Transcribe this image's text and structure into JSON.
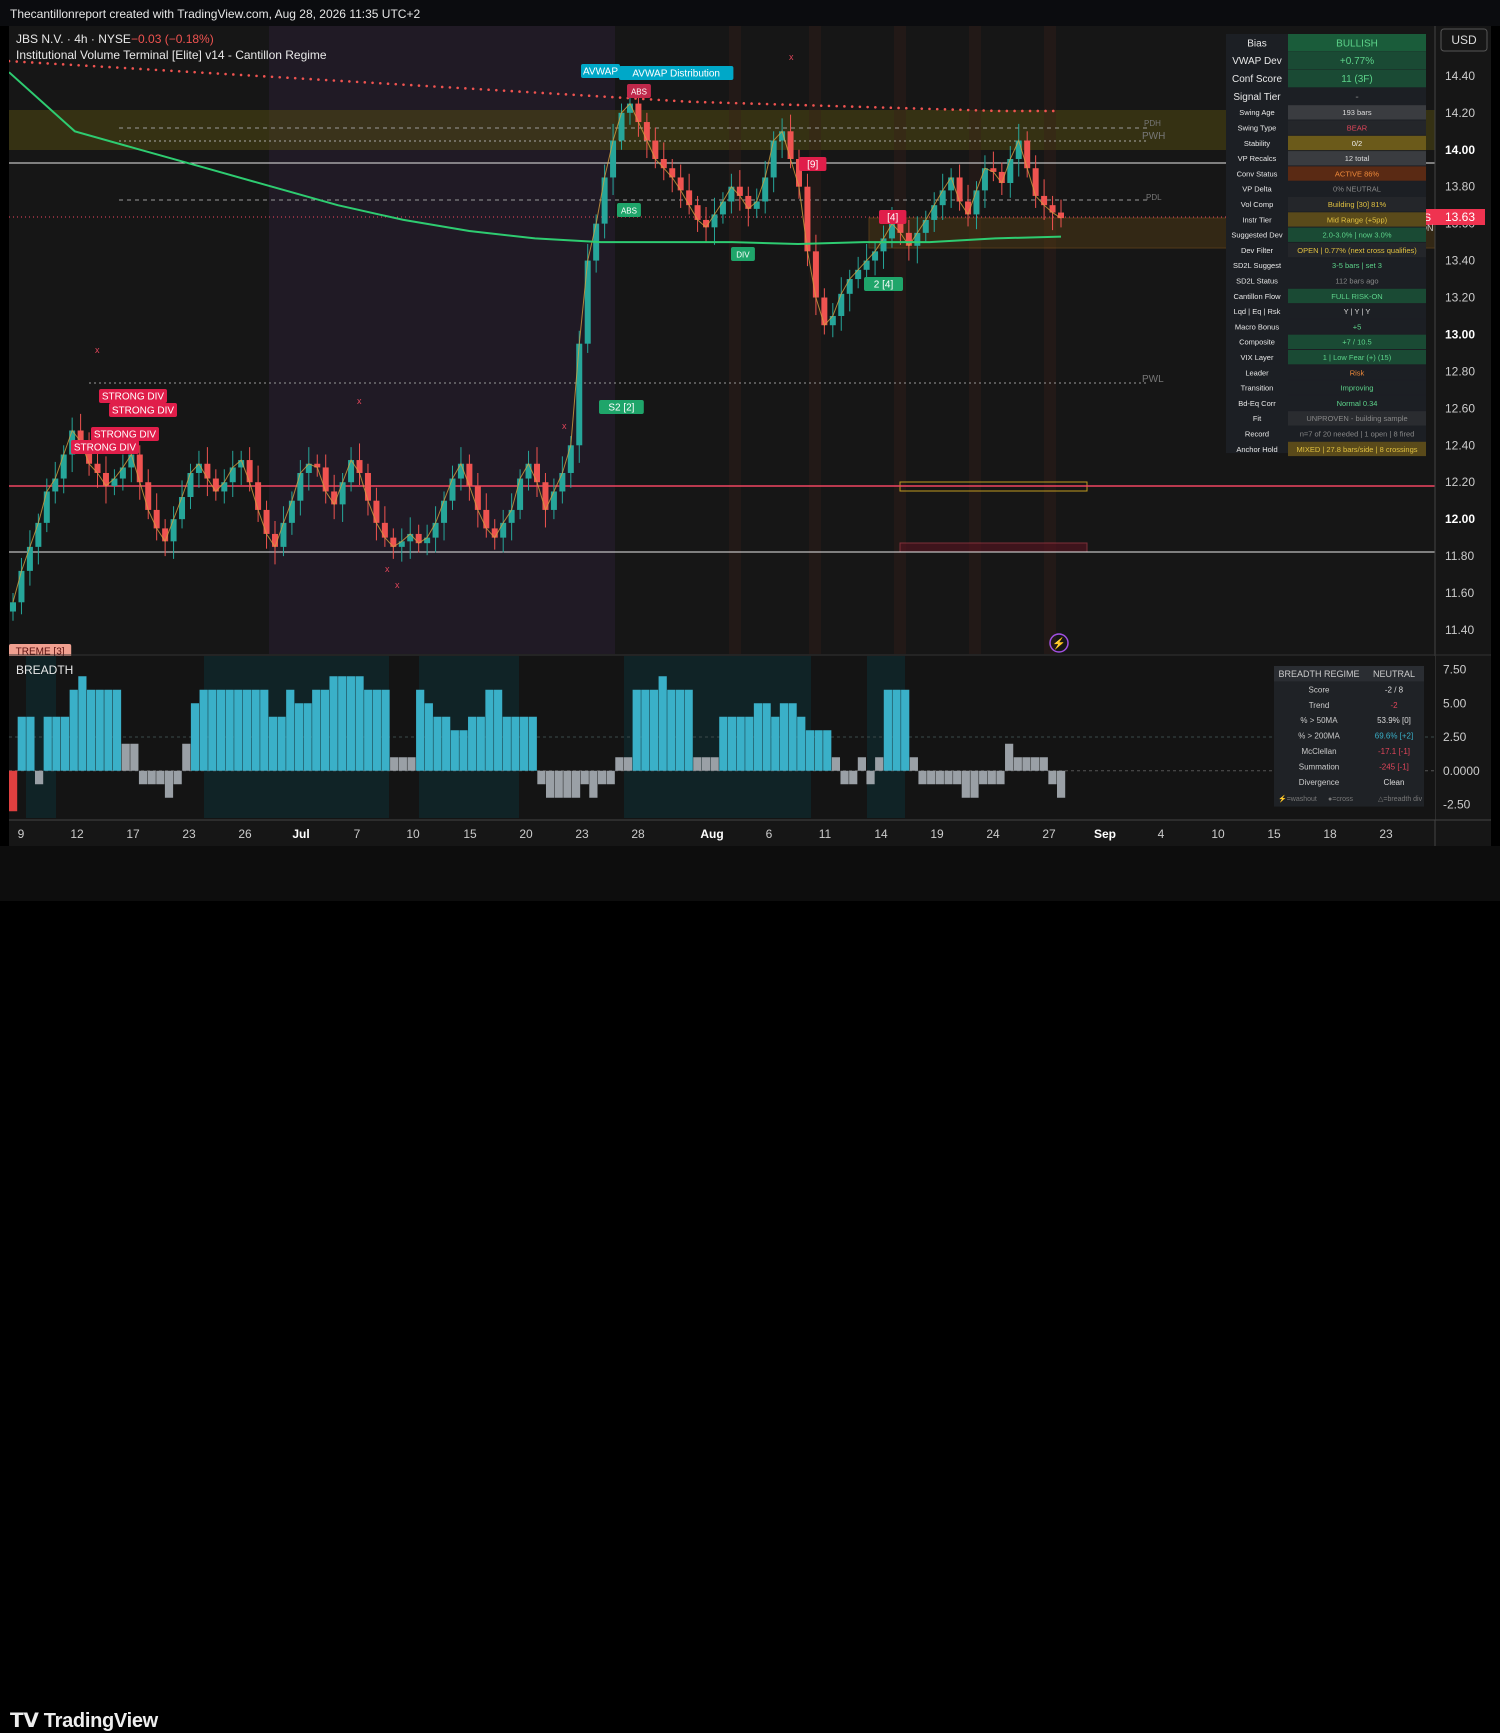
{
  "header": {
    "caption": "Thecantillonreport created with TradingView.com, Aug 28, 2026 11:35 UTC+2"
  },
  "symbol": {
    "line1_name": "JBS N.V. · 4h · NYSE",
    "line1_change": "−0.03 (−0.18%)",
    "indicator_title": "Institutional Volume Terminal [Elite] v14 - Cantillon Regime"
  },
  "currency_button": "USD",
  "price_tag": {
    "ticker": "JBS",
    "price": "13.63"
  },
  "footer": {
    "logo": "TradingView"
  },
  "colors": {
    "up": "#26a69a",
    "down": "#ef5350",
    "bg": "#161616",
    "breadth_up": "#3ab0c8",
    "breadth_neutral": "#9aa0a6"
  },
  "chart_data": [
    {
      "type": "candlestick",
      "title": "JBS N.V. · 4h · NYSE",
      "y_ticks": [
        "14.40",
        "14.20",
        "14.00",
        "13.80",
        "13.60",
        "13.40",
        "13.20",
        "13.00",
        "12.80",
        "12.60",
        "12.40",
        "12.20",
        "12.00",
        "11.80",
        "11.60",
        "11.40"
      ],
      "ylim": [
        11.27,
        14.67
      ],
      "last_price": 13.63,
      "x_ticks": [
        "9",
        "12",
        "17",
        "23",
        "26",
        "Jul",
        "7",
        "10",
        "15",
        "20",
        "23",
        "28",
        "Aug",
        "6",
        "11",
        "14",
        "19",
        "24",
        "27",
        "Sep",
        "4",
        "10",
        "15",
        "18",
        "23"
      ],
      "closes": [
        11.55,
        11.72,
        11.85,
        11.98,
        12.15,
        12.22,
        12.35,
        12.48,
        12.42,
        12.3,
        12.25,
        12.18,
        12.22,
        12.28,
        12.35,
        12.2,
        12.05,
        11.95,
        11.88,
        12.0,
        12.12,
        12.25,
        12.3,
        12.22,
        12.15,
        12.2,
        12.28,
        12.32,
        12.2,
        12.05,
        11.92,
        11.85,
        11.98,
        12.1,
        12.25,
        12.3,
        12.28,
        12.15,
        12.08,
        12.2,
        12.32,
        12.25,
        12.1,
        11.98,
        11.9,
        11.85,
        11.88,
        11.92,
        11.87,
        11.9,
        11.98,
        12.1,
        12.22,
        12.3,
        12.18,
        12.05,
        11.95,
        11.9,
        11.98,
        12.05,
        12.22,
        12.3,
        12.2,
        12.05,
        12.15,
        12.25,
        12.4,
        12.95,
        13.4,
        13.6,
        13.85,
        14.05,
        14.2,
        14.25,
        14.15,
        14.05,
        13.95,
        13.9,
        13.85,
        13.78,
        13.7,
        13.62,
        13.58,
        13.65,
        13.72,
        13.8,
        13.75,
        13.68,
        13.72,
        13.85,
        14.05,
        14.1,
        13.95,
        13.8,
        13.45,
        13.2,
        13.05,
        13.1,
        13.22,
        13.3,
        13.35,
        13.4,
        13.45,
        13.52,
        13.6,
        13.55,
        13.48,
        13.55,
        13.62,
        13.7,
        13.78,
        13.85,
        13.72,
        13.65,
        13.78,
        13.9,
        13.88,
        13.82,
        13.95,
        14.05,
        13.9,
        13.75,
        13.7,
        13.66,
        13.63
      ],
      "annotations": [
        "STRONG DIV",
        "STRONG DIV",
        "STRONG DIV",
        "STRONG DIV",
        "S2 [2]",
        "ABS",
        "ABS",
        "DIV",
        "[9]",
        "[4]",
        "2 [4]",
        "AVWAP",
        "AVWAP Distribution",
        "PDH",
        "PWH",
        "PDL",
        "PWL",
        "INSTITUTION",
        "TREME [3]"
      ],
      "series": [
        {
          "name": "AVWAP",
          "values": [
            14.48,
            14.46,
            14.44,
            14.42,
            14.4,
            14.38,
            14.36,
            14.34,
            14.32,
            14.3,
            14.28,
            14.26,
            14.25,
            14.24,
            14.23,
            14.22,
            14.21,
            14.21
          ]
        },
        {
          "name": "Long MA",
          "values": [
            14.42,
            14.1,
            14.0,
            13.9,
            13.8,
            13.7,
            13.62,
            13.56,
            13.52,
            13.5,
            13.5,
            13.5,
            13.49,
            13.5,
            13.5,
            13.52,
            13.53
          ]
        }
      ]
    },
    {
      "type": "bar",
      "title": "BREADTH",
      "y_ticks": [
        "7.50",
        "5.00",
        "2.50",
        "0.0000",
        "-2.50"
      ],
      "ylim": [
        -3.5,
        8.5
      ],
      "values": [
        -3,
        4,
        4,
        -1,
        4,
        4,
        4,
        6,
        7,
        6,
        6,
        6,
        6,
        2,
        2,
        -1,
        -1,
        -1,
        -2,
        -1,
        2,
        5,
        6,
        6,
        6,
        6,
        6,
        6,
        6,
        6,
        4,
        4,
        6,
        5,
        5,
        6,
        6,
        7,
        7,
        7,
        7,
        6,
        6,
        6,
        1,
        1,
        1,
        6,
        5,
        4,
        4,
        3,
        3,
        4,
        4,
        6,
        6,
        4,
        4,
        4,
        4,
        -1,
        -2,
        -2,
        -2,
        -2,
        -1,
        -2,
        -1,
        -1,
        1,
        1,
        6,
        6,
        6,
        7,
        6,
        6,
        6,
        1,
        1,
        1,
        4,
        4,
        4,
        4,
        5,
        5,
        4,
        5,
        5,
        4,
        3,
        3,
        3,
        1,
        -1,
        -1,
        1,
        -1,
        1,
        6,
        6,
        6,
        1,
        -1,
        -1,
        -1,
        -1,
        -1,
        -2,
        -2,
        -1,
        -1,
        -1,
        2,
        1,
        1,
        1,
        1,
        -1,
        -2
      ]
    }
  ],
  "regime_table": [
    {
      "k": "Bias",
      "v": "BULLISH",
      "bg": "#1a5c3a",
      "fg": "#5cd38a"
    },
    {
      "k": "VWAP Dev",
      "v": "+0.77%",
      "bg": "#1a4a34",
      "fg": "#5cd38a"
    },
    {
      "k": "Conf Score",
      "v": "11 (3F)",
      "bg": "#1a4a34",
      "fg": "#5cd38a"
    },
    {
      "k": "Signal Tier",
      "v": "-",
      "bg": "#1c1f24",
      "fg": "#888"
    },
    {
      "k": "Swing Age",
      "v": "193 bars",
      "bg": "#3a3c40",
      "fg": "#ddd"
    },
    {
      "k": "Swing Type",
      "v": "BEAR",
      "bg": "#24262a",
      "fg": "#e0455a"
    },
    {
      "k": "Stability",
      "v": "0/2",
      "bg": "#6b5a1a",
      "fg": "#eee"
    },
    {
      "k": "VP Recalcs",
      "v": "12 total",
      "bg": "#3a3c40",
      "fg": "#ddd"
    },
    {
      "k": "Conv Status",
      "v": "ACTIVE 86%",
      "bg": "#5a2a14",
      "fg": "#f08a3a"
    },
    {
      "k": "VP Delta",
      "v": "0% NEUTRAL",
      "bg": "#1c1f24",
      "fg": "#888"
    },
    {
      "k": "Vol Comp",
      "v": "Building [30] 81%",
      "bg": "#24262a",
      "fg": "#e0c040"
    },
    {
      "k": "Instr Tier",
      "v": "Mid Range (+5pp)",
      "bg": "#5a4a1a",
      "fg": "#e0c040"
    },
    {
      "k": "Suggested Dev",
      "v": "2.0-3.0% | now 3.0%",
      "bg": "#1a4a34",
      "fg": "#5cd38a"
    },
    {
      "k": "Dev Filter",
      "v": "OPEN | 0.77% (next cross qualifies)",
      "bg": "#24262a",
      "fg": "#e0c040"
    },
    {
      "k": "SD2L Suggest",
      "v": "3-5 bars | set 3",
      "bg": "#1c1f24",
      "fg": "#5cd38a"
    },
    {
      "k": "SD2L Status",
      "v": "112 bars ago",
      "bg": "#1c1f24",
      "fg": "#888"
    },
    {
      "k": "Cantillon Flow",
      "v": "FULL RISK-ON",
      "bg": "#1a4a34",
      "fg": "#5cd38a"
    },
    {
      "k": "Lqd | Eq | Rsk",
      "v": "Y | Y | Y",
      "bg": "#1c1f24",
      "fg": "#ddd"
    },
    {
      "k": "Macro Bonus",
      "v": "+5",
      "bg": "#1c1f24",
      "fg": "#5cd38a"
    },
    {
      "k": "Composite",
      "v": "+7 / 10.5",
      "bg": "#1a4a34",
      "fg": "#5cd38a"
    },
    {
      "k": "VIX Layer",
      "v": "1 | Low Fear (+) (15)",
      "bg": "#1a4a34",
      "fg": "#5cd38a"
    },
    {
      "k": "Leader",
      "v": "Risk",
      "bg": "#1c1f24",
      "fg": "#f08a3a"
    },
    {
      "k": "Transition",
      "v": "Improving",
      "bg": "#1c1f24",
      "fg": "#5cd38a"
    },
    {
      "k": "Bd-Eq Corr",
      "v": "Normal 0.34",
      "bg": "#1c1f24",
      "fg": "#5cd38a"
    },
    {
      "k": "Fit",
      "v": "UNPROVEN - building sample",
      "bg": "#2a2c30",
      "fg": "#888"
    },
    {
      "k": "Record",
      "v": "n=7 of 20 needed | 1 open | 8 fired",
      "bg": "#1c1f24",
      "fg": "#888"
    },
    {
      "k": "Anchor Hold",
      "v": "MIXED | 27.8 bars/side | 8 crossings",
      "bg": "#5a4a1a",
      "fg": "#e0c040"
    }
  ],
  "breadth_table": {
    "header": [
      "BREADTH REGIME",
      "NEUTRAL"
    ],
    "rows": [
      {
        "k": "Score",
        "v": "-2 / 8",
        "fg": "#ddd"
      },
      {
        "k": "Trend",
        "v": "-2",
        "fg": "#e0455a"
      },
      {
        "k": "% > 50MA",
        "v": "53.9%  [0]",
        "fg": "#ddd"
      },
      {
        "k": "% > 200MA",
        "v": "69.6%  [+2]",
        "fg": "#3ab0c8"
      },
      {
        "k": "McClellan",
        "v": "-17.1  [-1]",
        "fg": "#e0455a"
      },
      {
        "k": "Summation",
        "v": "-245  [-1]",
        "fg": "#e0455a"
      },
      {
        "k": "Divergence",
        "v": "Clean",
        "fg": "#ddd"
      }
    ],
    "legend": [
      "⚡=washout",
      "●=cross",
      "△=breadth div"
    ]
  }
}
